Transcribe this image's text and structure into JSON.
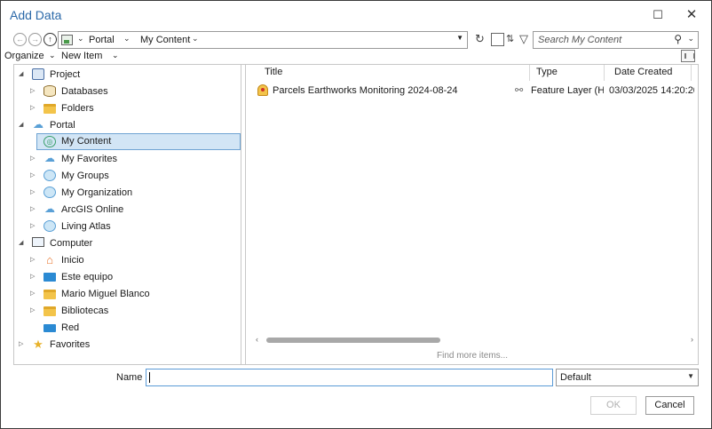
{
  "window": {
    "title": "Add Data",
    "minimize_glyph": "☐",
    "close_glyph": "✕"
  },
  "navbar": {
    "back_icon": "back-circle-icon",
    "forward_icon": "forward-circle-icon",
    "up_icon": "up-circle-icon",
    "breadcrumbs": [
      "Portal",
      "My Content"
    ],
    "search_placeholder": "Search My Content"
  },
  "commandbar": {
    "organize_label": "Organize",
    "new_item_label": "New Item"
  },
  "tree": {
    "items": [
      {
        "label": "Project",
        "icon": "project-icon",
        "level": 0,
        "expanded": true
      },
      {
        "label": "Databases",
        "icon": "database-icon",
        "level": 1,
        "expanded": false
      },
      {
        "label": "Folders",
        "icon": "folder-icon",
        "level": 1,
        "expanded": false
      },
      {
        "label": "Portal",
        "icon": "cloud-icon",
        "level": 0,
        "expanded": true
      },
      {
        "label": "My Content",
        "icon": "my-content-icon",
        "level": 1,
        "selected": true
      },
      {
        "label": "My Favorites",
        "icon": "favorites-cloud-icon",
        "level": 1,
        "expanded": false
      },
      {
        "label": "My Groups",
        "icon": "groups-icon",
        "level": 1,
        "expanded": false
      },
      {
        "label": "My Organization",
        "icon": "organization-icon",
        "level": 1,
        "expanded": false
      },
      {
        "label": "ArcGIS Online",
        "icon": "cloud-icon",
        "level": 1,
        "expanded": false
      },
      {
        "label": "Living Atlas",
        "icon": "globe-icon",
        "level": 1,
        "expanded": false
      },
      {
        "label": "Computer",
        "icon": "computer-icon",
        "level": 0,
        "expanded": true
      },
      {
        "label": "Inicio",
        "icon": "home-icon",
        "level": 1,
        "expanded": false
      },
      {
        "label": "Este equipo",
        "icon": "monitor-icon",
        "level": 1,
        "expanded": false
      },
      {
        "label": "Mario Miguel Blanco",
        "icon": "folder-icon",
        "level": 1,
        "expanded": false
      },
      {
        "label": "Bibliotecas",
        "icon": "folder-icon",
        "level": 1,
        "expanded": false
      },
      {
        "label": "Red",
        "icon": "network-icon",
        "level": 1
      },
      {
        "label": "Favorites",
        "icon": "star-icon",
        "level": 0,
        "expanded": false
      }
    ]
  },
  "content": {
    "columns": [
      "Title",
      "Type",
      "Date Created"
    ],
    "rows": [
      {
        "title": "Parcels Earthworks Monitoring 2024-08-24",
        "type": "Feature Layer (Hos",
        "date": "03/03/2025 14:20:20"
      }
    ],
    "find_more": "Find more items..."
  },
  "footer": {
    "name_label": "Name",
    "name_value": "",
    "type_value": "Default",
    "ok_label": "OK",
    "cancel_label": "Cancel"
  },
  "colors": {
    "title": "#2a68a8",
    "selection_bg": "#d2e5f5",
    "selection_border": "#6fa3d3"
  }
}
